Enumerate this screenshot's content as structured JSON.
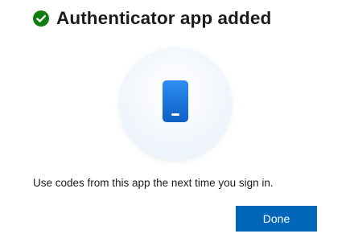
{
  "dialog": {
    "title": "Authenticator app added",
    "title_icon": "check-circle-icon",
    "illustration_icon": "phone-icon",
    "message": "Use codes from this app the next time you sign in.",
    "done_label": "Done"
  },
  "colors": {
    "success": "#107c10",
    "accent": "#0067b8",
    "phone": "#1a73d9",
    "text": "#1b1b1b"
  }
}
